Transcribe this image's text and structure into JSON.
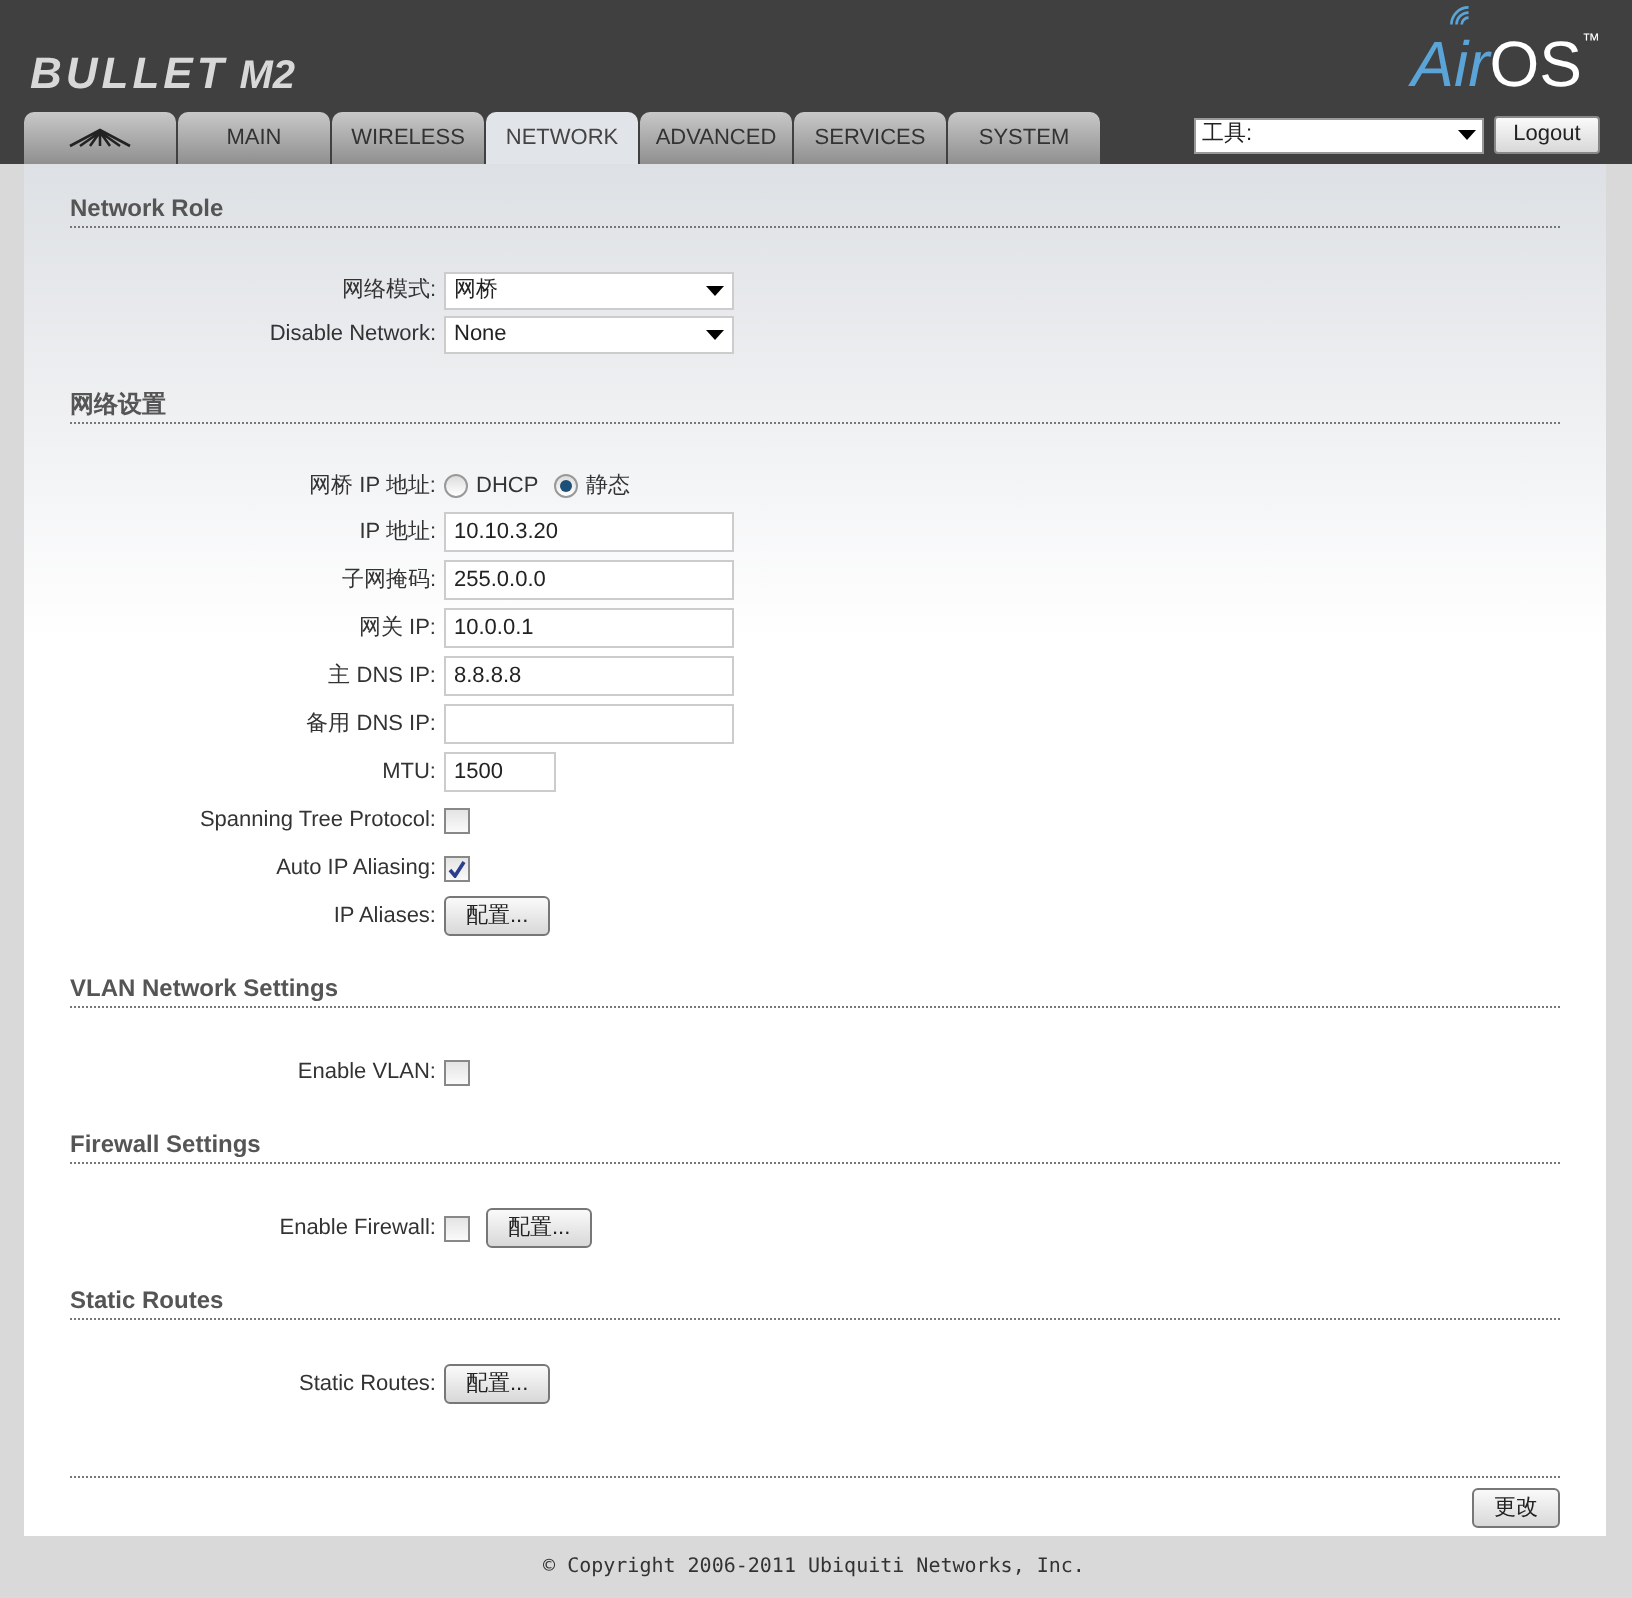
{
  "header": {
    "product": "BULLET",
    "model": "M2",
    "brand_a": "Air",
    "brand_b": "OS",
    "trademark": "™"
  },
  "tabs": [
    {
      "kind": "logo",
      "selected": false
    },
    {
      "kind": "text",
      "label": "MAIN",
      "selected": false
    },
    {
      "kind": "text",
      "label": "WIRELESS",
      "selected": false
    },
    {
      "kind": "text",
      "label": "NETWORK",
      "selected": true
    },
    {
      "kind": "text",
      "label": "ADVANCED",
      "selected": false
    },
    {
      "kind": "text",
      "label": "SERVICES",
      "selected": false
    },
    {
      "kind": "text",
      "label": "SYSTEM",
      "selected": false
    }
  ],
  "tools_select": {
    "value": "工具:"
  },
  "logout_button": "Logout",
  "sections": [
    {
      "title": "Network Role",
      "rows": [
        {
          "kind": "select",
          "label": "网络模式:",
          "value": "网桥"
        },
        {
          "kind": "select",
          "label": "Disable Network:",
          "value": "None"
        }
      ]
    },
    {
      "title": "网络设置",
      "rows": [
        {
          "kind": "radio",
          "label": "网桥 IP 地址:",
          "options": [
            {
              "label": "DHCP",
              "selected": false
            },
            {
              "label": "静态",
              "selected": true
            }
          ]
        },
        {
          "kind": "text",
          "label": "IP 地址:",
          "value": "10.10.3.20"
        },
        {
          "kind": "text",
          "label": "子网掩码:",
          "value": "255.0.0.0"
        },
        {
          "kind": "text",
          "label": "网关 IP:",
          "value": "10.0.0.1"
        },
        {
          "kind": "text",
          "label": "主 DNS IP:",
          "value": "8.8.8.8"
        },
        {
          "kind": "text",
          "label": "备用 DNS IP:",
          "value": ""
        },
        {
          "kind": "short",
          "label": "MTU:",
          "value": "1500"
        },
        {
          "kind": "checkbox",
          "label": "Spanning Tree Protocol:",
          "checked": false
        },
        {
          "kind": "checkbox",
          "label": "Auto IP Aliasing:",
          "checked": true
        },
        {
          "kind": "button",
          "label": "IP Aliases:",
          "button": "配置..."
        }
      ]
    },
    {
      "title": "VLAN Network Settings",
      "rows": [
        {
          "kind": "checkbox",
          "label": "Enable VLAN:",
          "checked": false
        }
      ]
    },
    {
      "title": "Firewall Settings",
      "rows": [
        {
          "kind": "checkbox",
          "label": "Enable Firewall:",
          "checked": false,
          "button": "配置..."
        }
      ]
    },
    {
      "title": "Static Routes",
      "rows": [
        {
          "kind": "button",
          "label": "Static Routes:",
          "button": "配置..."
        }
      ]
    }
  ],
  "apply_button": "更改",
  "footer": "© Copyright 2006-2011 Ubiquiti Networks, Inc."
}
